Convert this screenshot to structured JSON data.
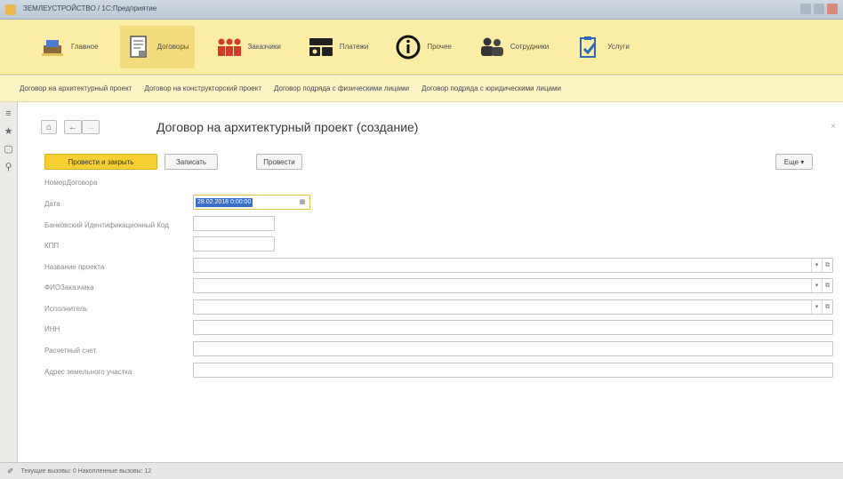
{
  "window": {
    "title": "ЗЕМЛЕУСТРОЙСТВО / 1С:Предприятие"
  },
  "sections": [
    {
      "label": "Главное",
      "icon": "home-icon"
    },
    {
      "label": "Договоры",
      "icon": "document-icon",
      "active": true
    },
    {
      "label": "Заказчики",
      "icon": "people-icon"
    },
    {
      "label": "Платежи",
      "icon": "payment-icon"
    },
    {
      "label": "Прочее",
      "icon": "info-icon"
    },
    {
      "label": "Сотрудники",
      "icon": "employees-icon"
    },
    {
      "label": "Услуги",
      "icon": "services-icon"
    }
  ],
  "quick_links": [
    "Договор на архитектурный проект",
    "Договор на конструкторский проект",
    "Договор подряда с физическими лицами",
    "Договор подряда с юридическими лицами"
  ],
  "sidebar_icons": [
    "menu-icon",
    "star-icon",
    "history-icon",
    "search-icon"
  ],
  "form": {
    "title": "Договор на архитектурный проект (создание)",
    "close": "×",
    "home": "⌂",
    "back": "←",
    "forward": "→",
    "buttons": {
      "post_close": "Провести и закрыть",
      "save": "Записать",
      "post": "Провести",
      "more": "Еще  ▾"
    },
    "fields": [
      {
        "label": "НомерДоговора",
        "value": ""
      },
      {
        "label": "Дата",
        "value": "28.02.2018 0:00:00"
      },
      {
        "label": "Банковский Идентификационный Код",
        "value": ""
      },
      {
        "label": "КПП",
        "value": ""
      },
      {
        "label": "Название проекта",
        "value": ""
      },
      {
        "label": "ФИОЗаказчика",
        "value": ""
      },
      {
        "label": "Исполнитель",
        "value": ""
      },
      {
        "label": "ИНН",
        "value": ""
      },
      {
        "label": "Расчетный счет",
        "value": ""
      },
      {
        "label": "Адрес земельного участка",
        "value": ""
      }
    ]
  },
  "status": {
    "text": "Текущие вызовы: 0  Накопленные вызовы: 12"
  },
  "colors": {
    "accent": "#f6d033",
    "section_bar": "#fbeca6",
    "quick_bar": "#fbf3c4"
  }
}
